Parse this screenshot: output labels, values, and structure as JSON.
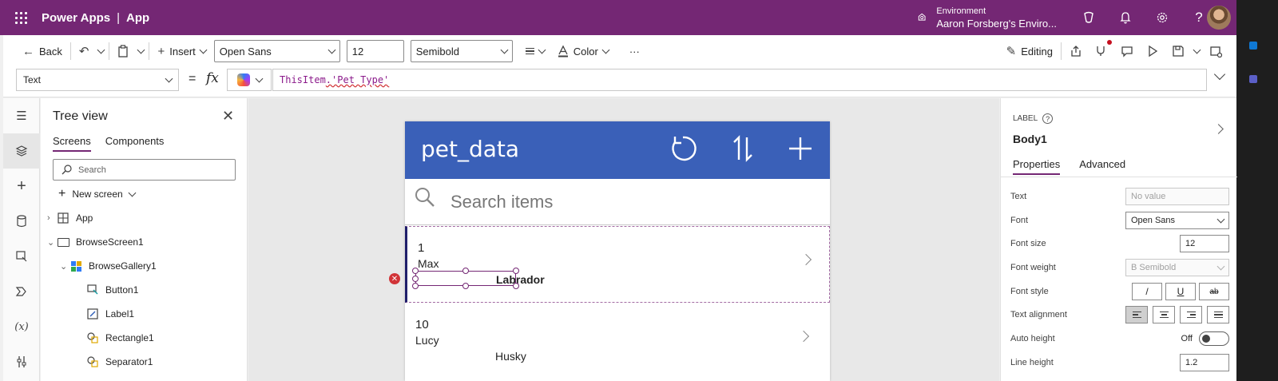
{
  "topbar": {
    "product": "Power Apps",
    "separator": "|",
    "app": "App",
    "environment_label": "Environment",
    "environment_name": "Aaron Forsberg's Enviro..."
  },
  "toolbar": {
    "back_label": "Back",
    "insert_label": "Insert",
    "font_value": "Open Sans",
    "font_size_value": "12",
    "font_weight_value": "Semibold",
    "color_label": "Color",
    "more_label": "···",
    "editing_label": "Editing"
  },
  "formula_bar": {
    "property": "Text",
    "equals": "=",
    "fx": "fx",
    "formula_a": "ThisItem",
    "formula_b": ".'Pet Type'"
  },
  "tree_view": {
    "title": "Tree view",
    "tabs": [
      "Screens",
      "Components"
    ],
    "search_placeholder": "Search",
    "new_screen_label": "New screen",
    "items": [
      {
        "label": "App",
        "icon": "app-icon"
      },
      {
        "label": "BrowseScreen1",
        "icon": "screen-icon"
      },
      {
        "label": "BrowseGallery1",
        "icon": "gallery-icon"
      },
      {
        "label": "Button1",
        "icon": "button-icon"
      },
      {
        "label": "Label1",
        "icon": "label-icon"
      },
      {
        "label": "Rectangle1",
        "icon": "shape-icon"
      },
      {
        "label": "Separator1",
        "icon": "shape-icon"
      }
    ]
  },
  "canvas": {
    "header_title": "pet_data",
    "search_placeholder": "Search items",
    "rows": [
      {
        "id": "1",
        "name": "Max",
        "type": "Labrador"
      },
      {
        "id": "10",
        "name": "Lucy",
        "type": "Husky"
      }
    ]
  },
  "properties": {
    "kind": "LABEL",
    "name": "Body1",
    "tabs": [
      "Properties",
      "Advanced"
    ],
    "text_label": "Text",
    "text_value": "No value",
    "font_label": "Font",
    "font_value": "Open Sans",
    "font_size_label": "Font size",
    "font_size_value": "12",
    "font_weight_label": "Font weight",
    "font_weight_value": "B  Semibold",
    "font_style_label": "Font style",
    "italic": "/",
    "underline": "U",
    "strike": "ab",
    "text_alignment_label": "Text alignment",
    "auto_height_label": "Auto height",
    "auto_height_value": "Off",
    "line_height_label": "Line height",
    "line_height_value": "1.2"
  },
  "colors": {
    "brand_purple": "#742774",
    "gallery_header": "#3a60b8",
    "error": "#d13438"
  }
}
